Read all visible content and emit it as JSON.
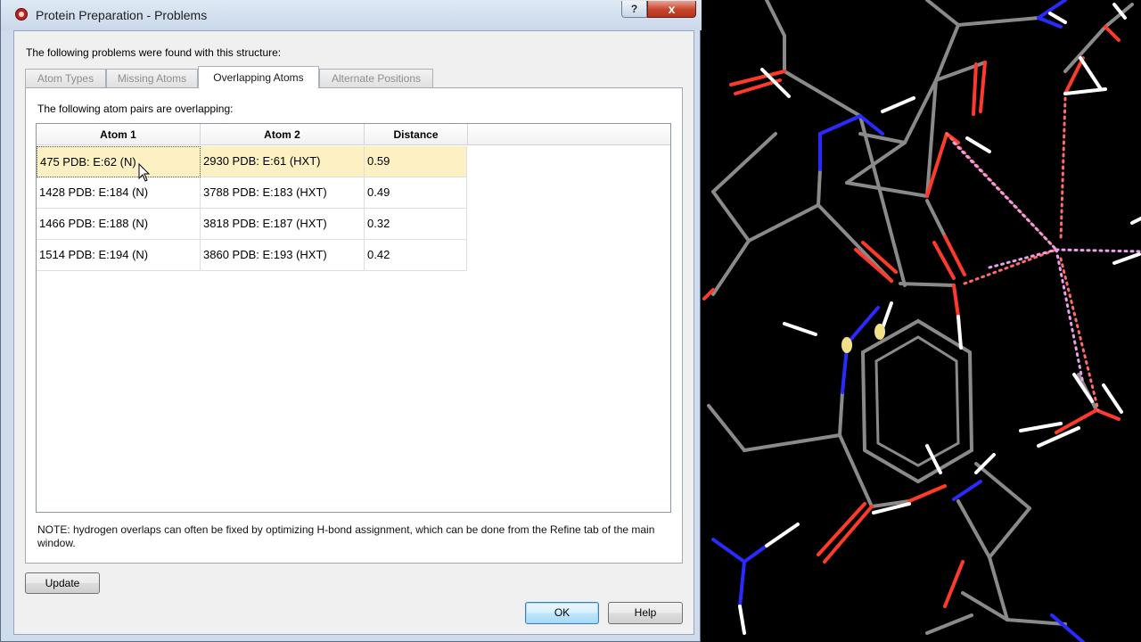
{
  "window": {
    "title": "Protein Preparation - Problems",
    "help_caption": "?",
    "close_caption": "x"
  },
  "intro_text": "The following problems were found with this structure:",
  "tabs": [
    {
      "label": "Atom Types",
      "active": false
    },
    {
      "label": "Missing Atoms",
      "active": false
    },
    {
      "label": "Overlapping Atoms",
      "active": true
    },
    {
      "label": "Alternate Positions",
      "active": false
    }
  ],
  "overlap_label": "The following atom pairs are overlapping:",
  "table": {
    "columns": [
      "Atom 1",
      "Atom 2",
      "Distance"
    ],
    "rows": [
      {
        "atom1": "475  PDB: E:62 (N)",
        "atom2": "2930  PDB: E:61 (HXT)",
        "distance": "0.59",
        "selected": true
      },
      {
        "atom1": "1428  PDB: E:184 (N)",
        "atom2": "3788  PDB: E:183 (HXT)",
        "distance": "0.49",
        "selected": false
      },
      {
        "atom1": "1466  PDB: E:188 (N)",
        "atom2": "3818  PDB: E:187 (HXT)",
        "distance": "0.32",
        "selected": false
      },
      {
        "atom1": "1514  PDB: E:194 (N)",
        "atom2": "3860  PDB: E:193 (HXT)",
        "distance": "0.42",
        "selected": false
      }
    ]
  },
  "note": "NOTE: hydrogen overlaps can often be fixed by optimizing H-bond assignment, which can be done from the Refine tab of the main window.",
  "buttons": {
    "update": "Update",
    "ok": "OK",
    "help": "Help"
  },
  "colors": {
    "selected_row": "#fdf1c3",
    "carbon": "#8a8a8a",
    "nitrogen": "#2a2aff",
    "oxygen": "#ff3a2a",
    "hydrogen": "#ffffff",
    "overlap_marker": "#f0e08a",
    "hbond": "#ff6a6a",
    "contact": "#e8a0e8"
  }
}
